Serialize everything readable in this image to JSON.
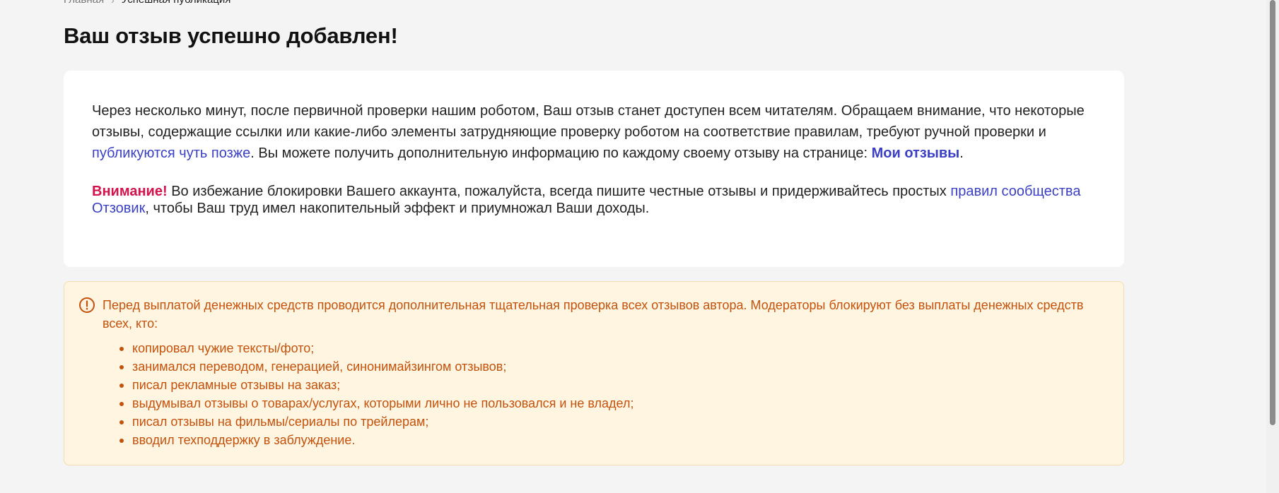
{
  "breadcrumb": {
    "home": "Главная",
    "separator": "›",
    "current": "Успешная публикация"
  },
  "page_title": "Ваш отзыв успешно добавлен!",
  "notice": {
    "p1_part1": "Через несколько минут, после первичной проверки нашим роботом, Ваш отзыв станет доступен всем читателям. Обращаем внимание, что некоторые отзывы, содержащие ссылки или какие-либо элементы затрудняющие проверку роботом на соответствие правилам, требуют ручной проверки и ",
    "p1_link": "публикуются чуть позже",
    "p1_part2": ". Вы можете получить дополнительную информацию по каждому своему отзыву на странице: ",
    "p1_link2": "Мои отзывы",
    "p1_end": ".",
    "warn_label": "Внимание!",
    "p2_part1": " Во избежание блокировки Вашего аккаунта, пожалуйста, всегда пишите честные отзывы и придерживайтесь простых ",
    "p2_link": "правил сообщества Отзовик",
    "p2_part2": ", чтобы Ваш труд имел накопительный эффект и приумножал Ваши доходы."
  },
  "warning": {
    "icon": "exclamation-circle-icon",
    "text": "Перед выплатой денежных средств проводится дополнительная тщательная проверка всех отзывов автора. Модераторы блокируют без выплаты денежных средств всех, кто:",
    "items": [
      "копировал чужие тексты/фото;",
      "занимался переводом, генерацией, синонимайзингом отзывов;",
      "писал рекламные отзывы на заказ;",
      "выдумывал отзывы о товарах/услугах, которыми лично не пользовался и не владел;",
      "писал отзывы на фильмы/сериалы по трейлерам;",
      "вводил техподдержку в заблуждение."
    ]
  },
  "colors": {
    "background": "#f4f4f5",
    "card": "#ffffff",
    "link": "#3b3fc4",
    "attention": "#d3134c",
    "warning_text": "#c4520d",
    "warning_bg": "#fff5e0"
  }
}
